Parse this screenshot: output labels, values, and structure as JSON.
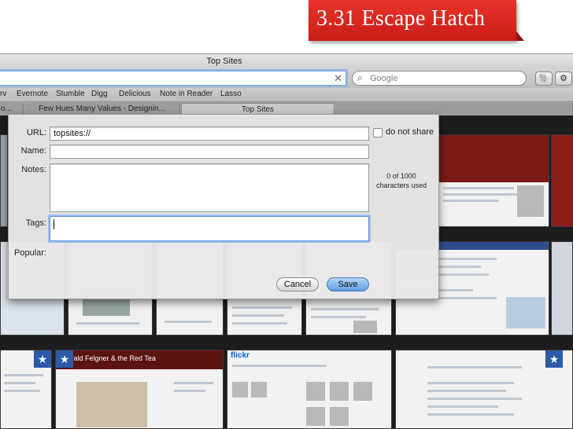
{
  "slide": {
    "title": "3.31 Escape Hatch"
  },
  "browser": {
    "window_title": "Top Sites",
    "search_placeholder": "Google",
    "bookmarks": [
      "rv",
      "Evernote",
      "Stumble",
      "Digg",
      "Delicious",
      "Note in Reader",
      "Lasso"
    ],
    "tabs": [
      {
        "label": "o..."
      },
      {
        "label": "Few Hues Many Values - Designin..."
      },
      {
        "label": "Top Sites"
      }
    ]
  },
  "dialog": {
    "url_label": "URL:",
    "url_value": "topsites://",
    "do_not_share_label": "do not share",
    "name_label": "Name:",
    "name_value": "",
    "notes_label": "Notes:",
    "notes_value": "",
    "notes_counter": "0 of 1000",
    "notes_counter_unit": "characters used",
    "tags_label": "Tags:",
    "tags_value": "",
    "popular_label": "Popular:",
    "cancel_label": "Cancel",
    "save_label": "Save"
  },
  "thumbnails": {
    "flickr_logo": "flickr",
    "harald_title": "Harald Felgner & the Red Tea"
  },
  "colors": {
    "banner": "#d9281f",
    "focus_ring": "#9ec0ec",
    "save_button": "#5f9ee6"
  }
}
